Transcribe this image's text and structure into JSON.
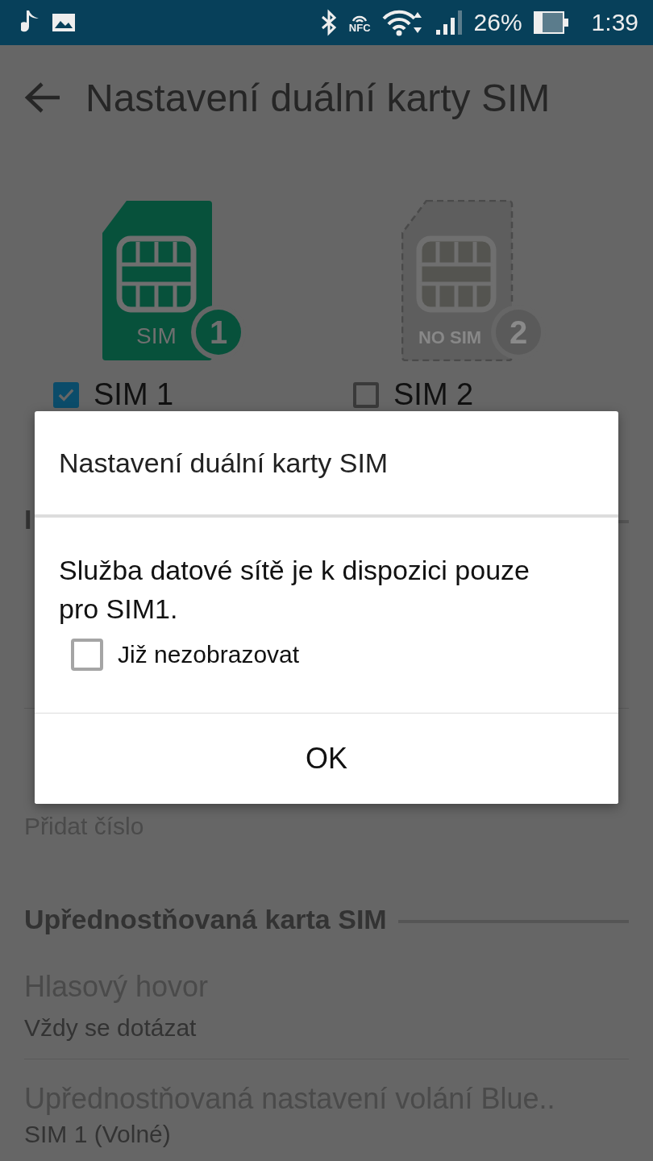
{
  "status_bar": {
    "nfc_label": "NFC",
    "battery": "26%",
    "time": "1:39"
  },
  "toolbar": {
    "title": "Nastavení duální karty SIM"
  },
  "sims": [
    {
      "card_label": "SIM",
      "badge": "1",
      "name": "SIM 1",
      "checked": true,
      "present": true
    },
    {
      "card_label": "NO SIM",
      "badge": "2",
      "name": "SIM 2",
      "checked": false,
      "present": false
    }
  ],
  "sections": [
    {
      "header": "I",
      "items": [
        {
          "summary": [
            {
              "text": "Přidat číslo",
              "disabled": true
            }
          ]
        }
      ]
    },
    {
      "header": "Upřednostňovaná karta SIM",
      "items": [
        {
          "title": "Hlasový hovor",
          "disabled": true,
          "summary": [
            {
              "text": "Vždy se dotázat",
              "disabled": false
            }
          ]
        },
        {
          "title": "Upřednostňovaná nastavení volání Blue..",
          "disabled": true,
          "summary": [
            {
              "text": "SIM 1 (Volné)",
              "disabled": false
            }
          ]
        }
      ]
    }
  ],
  "dialog": {
    "title": "Nastavení duální karty SIM",
    "message": "Služba datové sítě je k dispozici pouze pro SIM1.",
    "checkbox": {
      "label": "Již nezobrazovat",
      "checked": false
    },
    "button": "OK"
  }
}
